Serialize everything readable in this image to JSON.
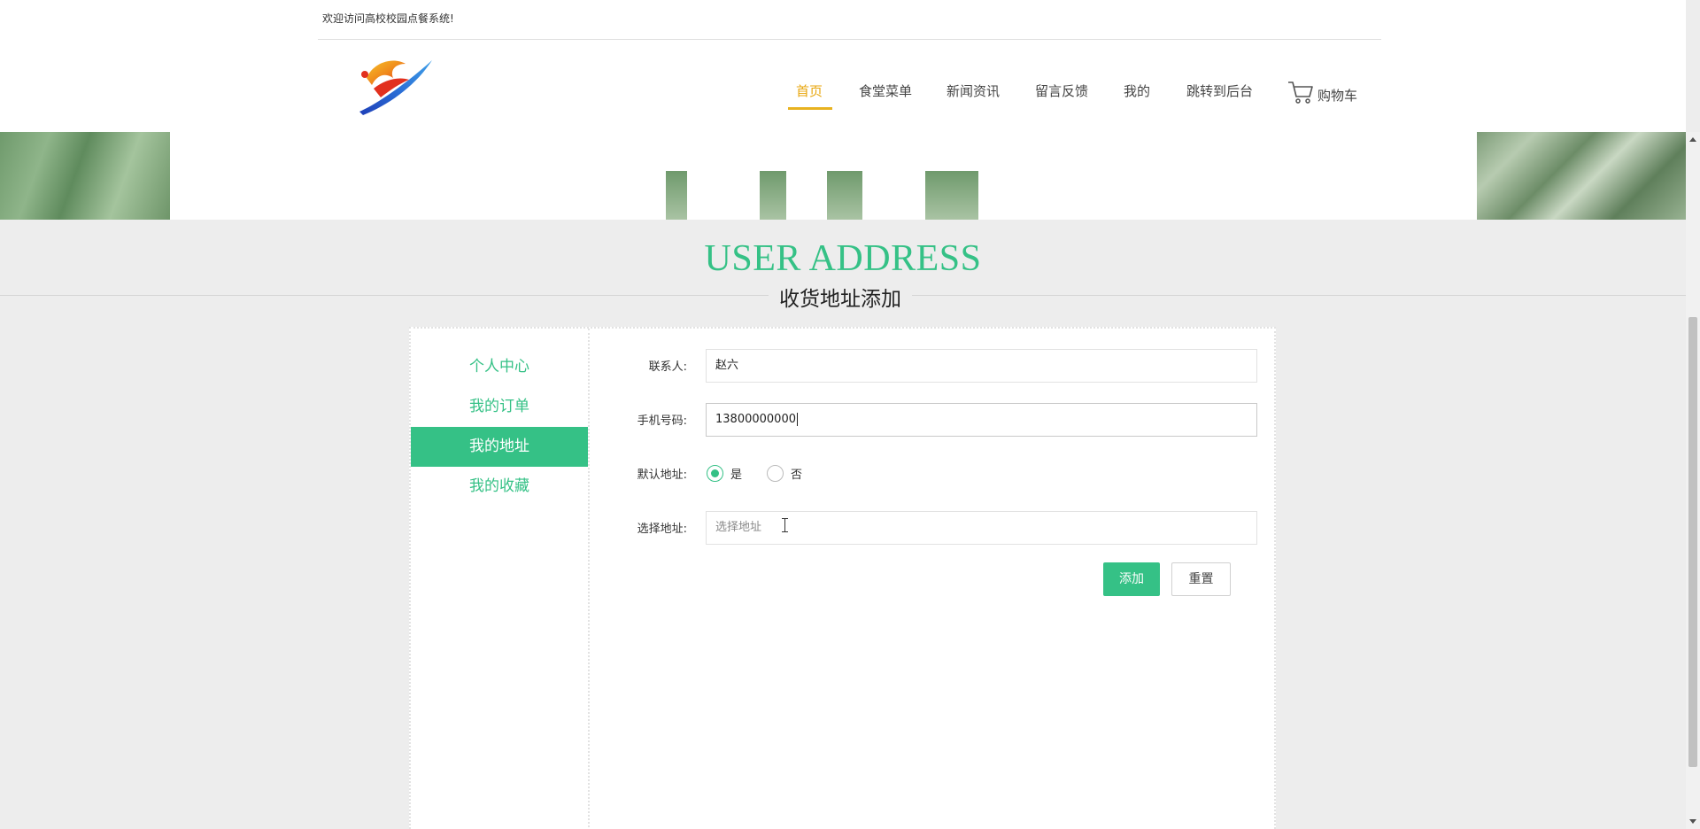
{
  "header": {
    "welcome": "欢迎访问高校校园点餐系统!",
    "nav": [
      {
        "label": "首页",
        "active": true
      },
      {
        "label": "食堂菜单",
        "active": false
      },
      {
        "label": "新闻资讯",
        "active": false
      },
      {
        "label": "留言反馈",
        "active": false
      },
      {
        "label": "我的",
        "active": false
      },
      {
        "label": "跳转到后台",
        "active": false
      }
    ],
    "cart_label": "购物车"
  },
  "section": {
    "title_en": "USER ADDRESS",
    "title_cn": "收货地址添加"
  },
  "sidebar": {
    "items": [
      {
        "label": "个人中心",
        "active": false
      },
      {
        "label": "我的订单",
        "active": false
      },
      {
        "label": "我的地址",
        "active": true
      },
      {
        "label": "我的收藏",
        "active": false
      }
    ]
  },
  "form": {
    "contact_label": "联系人:",
    "contact_value": "赵六",
    "phone_label": "手机号码:",
    "phone_value": "13800000000",
    "default_label": "默认地址:",
    "default_options": [
      {
        "label": "是",
        "checked": true
      },
      {
        "label": "否",
        "checked": false
      }
    ],
    "address_label": "选择地址:",
    "address_placeholder": "选择地址",
    "add_button": "添加",
    "reset_button": "重置"
  },
  "colors": {
    "accent": "#35c186",
    "nav_active": "#e8a60c"
  }
}
